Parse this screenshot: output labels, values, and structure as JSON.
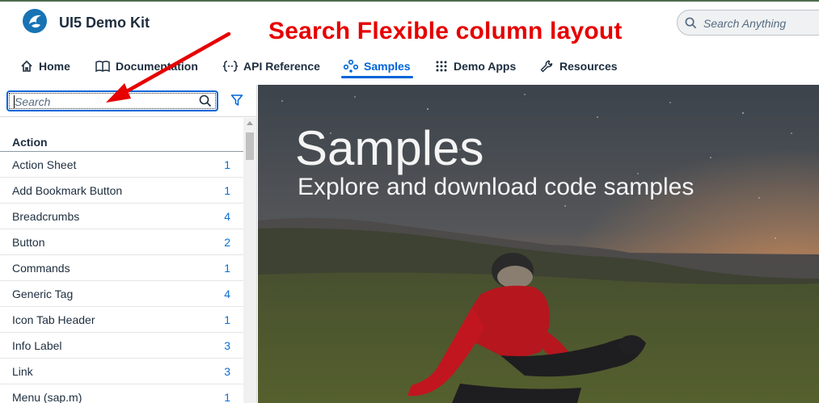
{
  "header": {
    "app_title": "UI5 Demo Kit",
    "annotation": "Search Flexible column layout",
    "search_placeholder": "Search Anything"
  },
  "nav": {
    "items": [
      {
        "label": "Home",
        "icon": "home-icon"
      },
      {
        "label": "Documentation",
        "icon": "documentation-icon"
      },
      {
        "label": "API Reference",
        "icon": "api-reference-icon"
      },
      {
        "label": "Samples",
        "icon": "samples-icon",
        "active": true
      },
      {
        "label": "Demo Apps",
        "icon": "grid-icon"
      },
      {
        "label": "Resources",
        "icon": "wrench-icon"
      }
    ]
  },
  "sidebar": {
    "filter_placeholder": "Search",
    "group": "Action",
    "items": [
      {
        "label": "Action Sheet",
        "count": "1"
      },
      {
        "label": "Add Bookmark Button",
        "count": "1"
      },
      {
        "label": "Breadcrumbs",
        "count": "4"
      },
      {
        "label": "Button",
        "count": "2"
      },
      {
        "label": "Commands",
        "count": "1"
      },
      {
        "label": "Generic Tag",
        "count": "4"
      },
      {
        "label": "Icon Tab Header",
        "count": "1"
      },
      {
        "label": "Info Label",
        "count": "3"
      },
      {
        "label": "Link",
        "count": "3"
      },
      {
        "label": "Menu (sap.m)",
        "count": "1"
      }
    ]
  },
  "hero": {
    "title": "Samples",
    "subtitle": "Explore and download code samples"
  },
  "colors": {
    "accent": "#0064d9",
    "annotation": "#e60000",
    "count": "#0a6ed1"
  }
}
